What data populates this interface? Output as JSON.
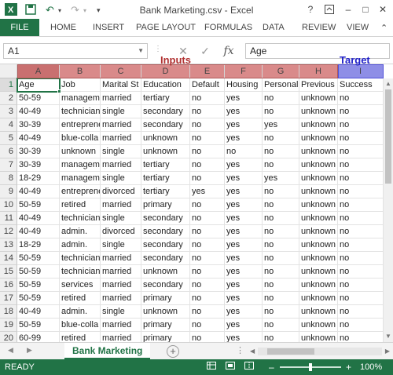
{
  "app": {
    "title": "Bank Marketing.csv - Excel",
    "help": "?",
    "restore": "□"
  },
  "ribbon": {
    "file": "FILE",
    "tabs": [
      "HOME",
      "INSERT",
      "PAGE LAYOUT",
      "FORMULAS",
      "DATA",
      "REVIEW",
      "VIEW"
    ]
  },
  "formula_bar": {
    "name_box": "A1",
    "fx": "fx",
    "value": "Age"
  },
  "annotations": {
    "inputs": "Inputs",
    "target": "Target"
  },
  "columns": [
    "A",
    "B",
    "C",
    "D",
    "E",
    "F",
    "G",
    "H",
    "I"
  ],
  "rows": [
    {
      "n": "1",
      "cells": [
        "Age",
        "Job",
        "Marital St",
        "Education",
        "Default",
        "Housing",
        "Personal",
        "Previous",
        "Success"
      ]
    },
    {
      "n": "2",
      "cells": [
        "50-59",
        "managem",
        "married",
        "tertiary",
        "no",
        "yes",
        "no",
        "unknown",
        "no"
      ]
    },
    {
      "n": "3",
      "cells": [
        "40-49",
        "technician",
        "single",
        "secondary",
        "no",
        "yes",
        "no",
        "unknown",
        "no"
      ]
    },
    {
      "n": "4",
      "cells": [
        "30-39",
        "entreprene",
        "married",
        "secondary",
        "no",
        "yes",
        "yes",
        "unknown",
        "no"
      ]
    },
    {
      "n": "5",
      "cells": [
        "40-49",
        "blue-colla",
        "married",
        "unknown",
        "no",
        "yes",
        "no",
        "unknown",
        "no"
      ]
    },
    {
      "n": "6",
      "cells": [
        "30-39",
        "unknown",
        "single",
        "unknown",
        "no",
        "no",
        "no",
        "unknown",
        "no"
      ]
    },
    {
      "n": "7",
      "cells": [
        "30-39",
        "managem",
        "married",
        "tertiary",
        "no",
        "yes",
        "no",
        "unknown",
        "no"
      ]
    },
    {
      "n": "8",
      "cells": [
        "18-29",
        "managem",
        "single",
        "tertiary",
        "no",
        "yes",
        "yes",
        "unknown",
        "no"
      ]
    },
    {
      "n": "9",
      "cells": [
        "40-49",
        "entreprene",
        "divorced",
        "tertiary",
        "yes",
        "yes",
        "no",
        "unknown",
        "no"
      ]
    },
    {
      "n": "10",
      "cells": [
        "50-59",
        "retired",
        "married",
        "primary",
        "no",
        "yes",
        "no",
        "unknown",
        "no"
      ]
    },
    {
      "n": "11",
      "cells": [
        "40-49",
        "technician",
        "single",
        "secondary",
        "no",
        "yes",
        "no",
        "unknown",
        "no"
      ]
    },
    {
      "n": "12",
      "cells": [
        "40-49",
        "admin.",
        "divorced",
        "secondary",
        "no",
        "yes",
        "no",
        "unknown",
        "no"
      ]
    },
    {
      "n": "13",
      "cells": [
        "18-29",
        "admin.",
        "single",
        "secondary",
        "no",
        "yes",
        "no",
        "unknown",
        "no"
      ]
    },
    {
      "n": "14",
      "cells": [
        "50-59",
        "technician",
        "married",
        "secondary",
        "no",
        "yes",
        "no",
        "unknown",
        "no"
      ]
    },
    {
      "n": "15",
      "cells": [
        "50-59",
        "technician",
        "married",
        "unknown",
        "no",
        "yes",
        "no",
        "unknown",
        "no"
      ]
    },
    {
      "n": "16",
      "cells": [
        "50-59",
        "services",
        "married",
        "secondary",
        "no",
        "yes",
        "no",
        "unknown",
        "no"
      ]
    },
    {
      "n": "17",
      "cells": [
        "50-59",
        "retired",
        "married",
        "primary",
        "no",
        "yes",
        "no",
        "unknown",
        "no"
      ]
    },
    {
      "n": "18",
      "cells": [
        "40-49",
        "admin.",
        "single",
        "unknown",
        "no",
        "yes",
        "no",
        "unknown",
        "no"
      ]
    },
    {
      "n": "19",
      "cells": [
        "50-59",
        "blue-colla",
        "married",
        "primary",
        "no",
        "yes",
        "no",
        "unknown",
        "no"
      ]
    },
    {
      "n": "20",
      "cells": [
        "60-99",
        "retired",
        "married",
        "primary",
        "no",
        "yes",
        "no",
        "unknown",
        "no"
      ]
    }
  ],
  "sheet": {
    "tab": "Bank Marketing",
    "add": "+"
  },
  "status": {
    "text": "READY",
    "zoom": "100%",
    "zoom_fraction": 0.5
  },
  "colors": {
    "excel_green": "#217346",
    "inputs_header": "#d98a8a",
    "target_header": "#8e8ee6",
    "inputs_label": "#b03030",
    "target_label": "#2020c8"
  }
}
